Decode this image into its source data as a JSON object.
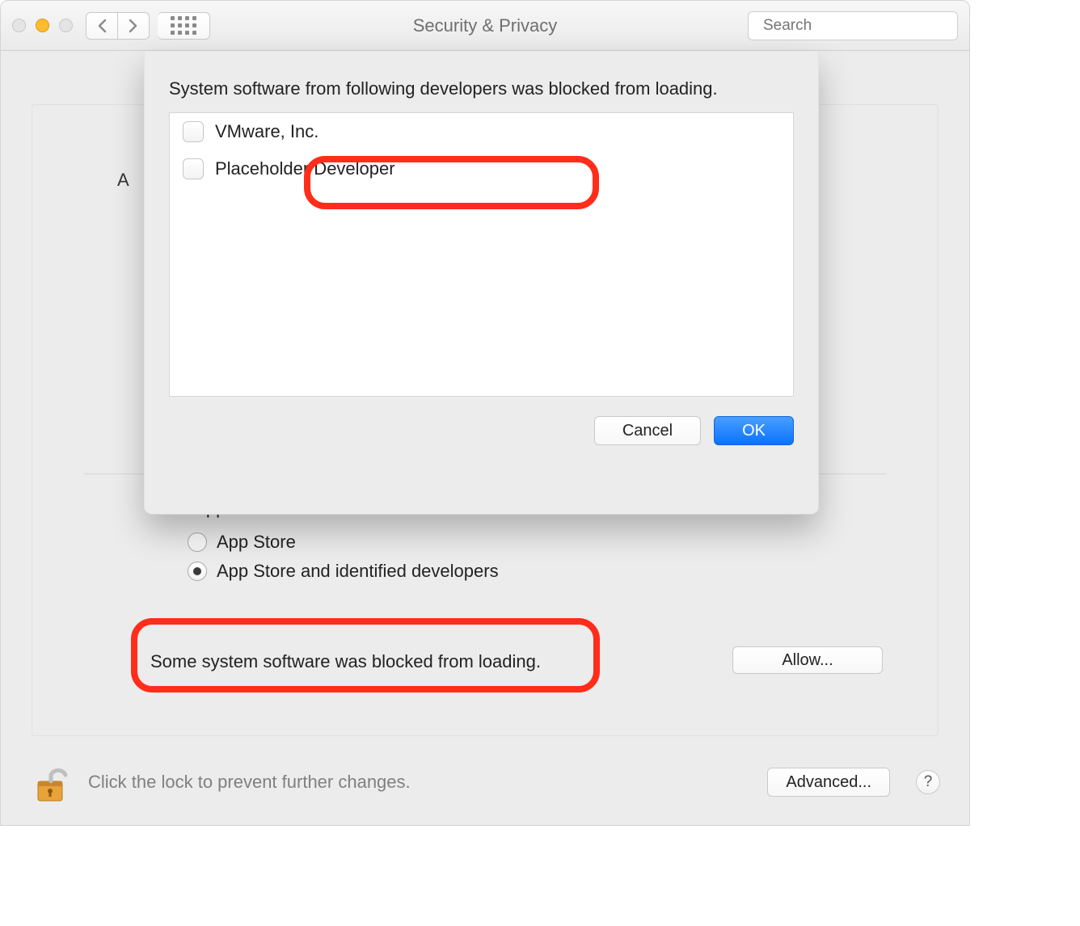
{
  "window": {
    "title": "Security & Privacy"
  },
  "toolbar": {
    "search_placeholder": "Search"
  },
  "panel": {
    "visible_char": "A",
    "allow_label": "Allow apps downloaded from:",
    "radio_options": [
      {
        "label": "App Store",
        "selected": false
      },
      {
        "label": "App Store and identified developers",
        "selected": true
      }
    ],
    "blocked_message": "Some system software was blocked from loading.",
    "allow_button": "Allow..."
  },
  "footer": {
    "lock_text": "Click the lock to prevent further changes.",
    "advanced_button": "Advanced...",
    "help_button": "?"
  },
  "sheet": {
    "heading": "System software from following developers was blocked from loading.",
    "developers": [
      {
        "name": "VMware, Inc.",
        "checked": false
      },
      {
        "name": "Placeholder Developer",
        "checked": false
      }
    ],
    "cancel": "Cancel",
    "ok": "OK"
  }
}
